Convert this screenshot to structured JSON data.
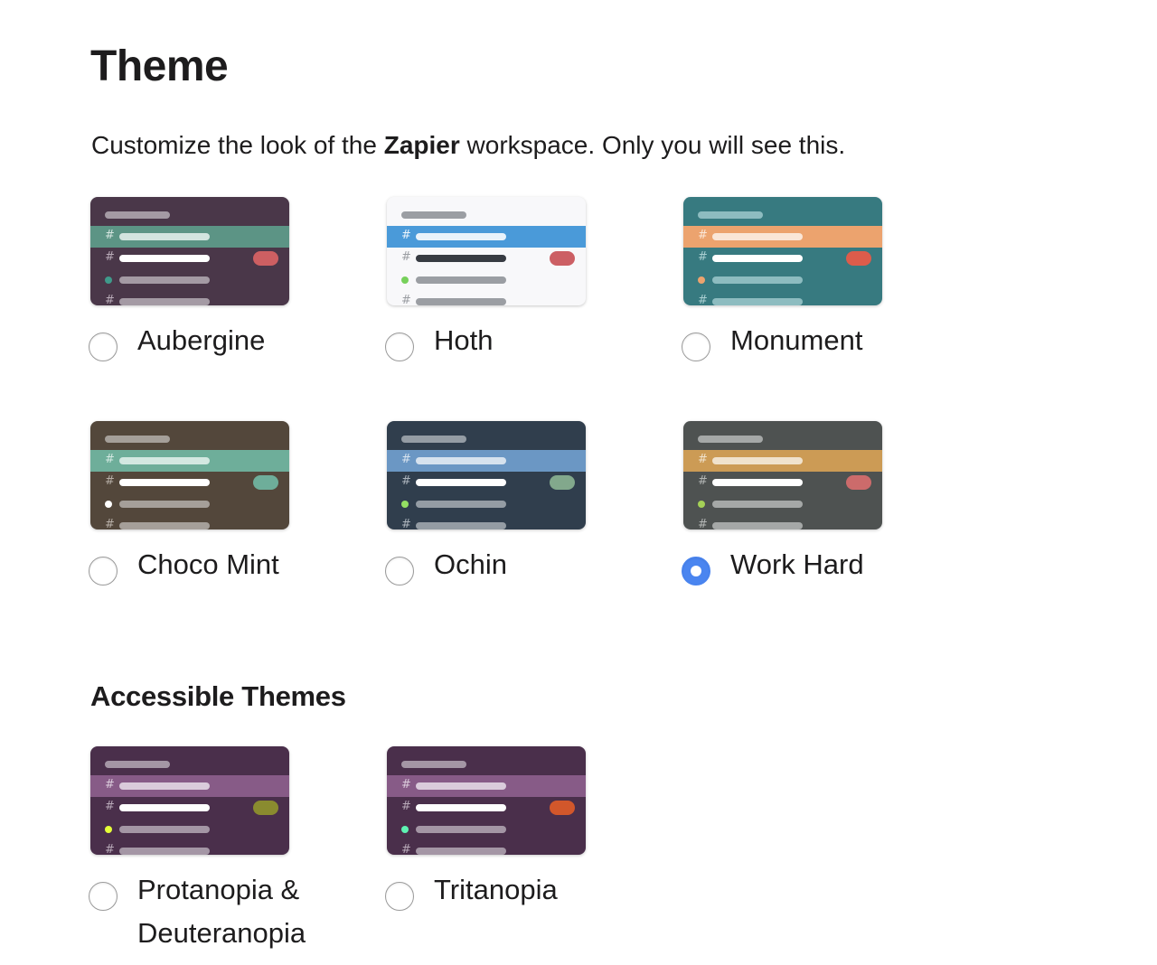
{
  "header": {
    "title": "Theme",
    "description_prefix": "Customize the look of the ",
    "workspace_name": "Zapier",
    "description_suffix": " workspace. Only you will see this."
  },
  "themes": [
    {
      "name": "Aubergine",
      "selected": false,
      "colors": {
        "bg": "#4a3749",
        "top_bar": "#a49aa4",
        "active_bg": "#5c9485",
        "active_bar": "#d3e4df",
        "hash": "#b8aab7",
        "text_bar": "#ffffff",
        "muted_bar": "#a49aa4",
        "dot": "#3f9a8b",
        "pill": "#cd5f62"
      }
    },
    {
      "name": "Hoth",
      "selected": false,
      "colors": {
        "bg": "#f8f8fa",
        "top_bar": "#9b9ea3",
        "active_bg": "#4a9ad9",
        "active_bar": "#e9f3fb",
        "hash": "#9b9ea3",
        "text_bar": "#373b42",
        "muted_bar": "#9b9ea3",
        "dot": "#77d05b",
        "pill": "#cc5f64"
      }
    },
    {
      "name": "Monument",
      "selected": false,
      "colors": {
        "bg": "#377a80",
        "top_bar": "#8dbcc0",
        "active_bg": "#eca36e",
        "active_bar": "#fae6d7",
        "hash": "#a9ced1",
        "text_bar": "#ffffff",
        "muted_bar": "#8dbcc0",
        "dot": "#eca36e",
        "pill": "#dc5c4b"
      }
    },
    {
      "name": "Choco Mint",
      "selected": false,
      "colors": {
        "bg": "#53473b",
        "top_bar": "#a59f99",
        "active_bg": "#6eae9a",
        "active_bar": "#d3e8e1",
        "hash": "#b6aea6",
        "text_bar": "#ffffff",
        "muted_bar": "#a59f99",
        "dot": "#ffffff",
        "pill": "#6eae9a"
      }
    },
    {
      "name": "Ochin",
      "selected": false,
      "colors": {
        "bg": "#303e4d",
        "top_bar": "#949ca4",
        "active_bg": "#6b97c4",
        "active_bar": "#d6e2ee",
        "hash": "#aab2ba",
        "text_bar": "#ffffff",
        "muted_bar": "#949ca4",
        "dot": "#94e063",
        "pill": "#82a88c"
      }
    },
    {
      "name": "Work Hard",
      "selected": true,
      "colors": {
        "bg": "#4e5251",
        "top_bar": "#a5a8a7",
        "active_bg": "#cc9b55",
        "active_bar": "#f0e2cc",
        "hash": "#b2b5b4",
        "text_bar": "#ffffff",
        "muted_bar": "#a5a8a7",
        "dot": "#a5d157",
        "pill": "#cc6b6b"
      }
    }
  ],
  "accessible": {
    "title": "Accessible Themes",
    "themes": [
      {
        "name": "Protanopia & Deuteranopia",
        "name_line1": "Protanopia &",
        "name_line2": "Deuteranopia",
        "selected": false,
        "colors": {
          "bg": "#4a2f4b",
          "top_bar": "#a496a5",
          "active_bg": "#875b87",
          "active_bar": "#dacbdb",
          "hash": "#b7a8b7",
          "text_bar": "#ffffff",
          "muted_bar": "#a496a5",
          "dot": "#e5ff38",
          "pill": "#8a8b2f"
        }
      },
      {
        "name": "Tritanopia",
        "selected": false,
        "colors": {
          "bg": "#4a2f4b",
          "top_bar": "#a496a5",
          "active_bg": "#875b87",
          "active_bar": "#dacbdb",
          "hash": "#b7a8b7",
          "text_bar": "#ffffff",
          "muted_bar": "#a496a5",
          "dot": "#5ef2b3",
          "pill": "#d2572b"
        }
      }
    ]
  },
  "accent_color": "#4a85f0"
}
